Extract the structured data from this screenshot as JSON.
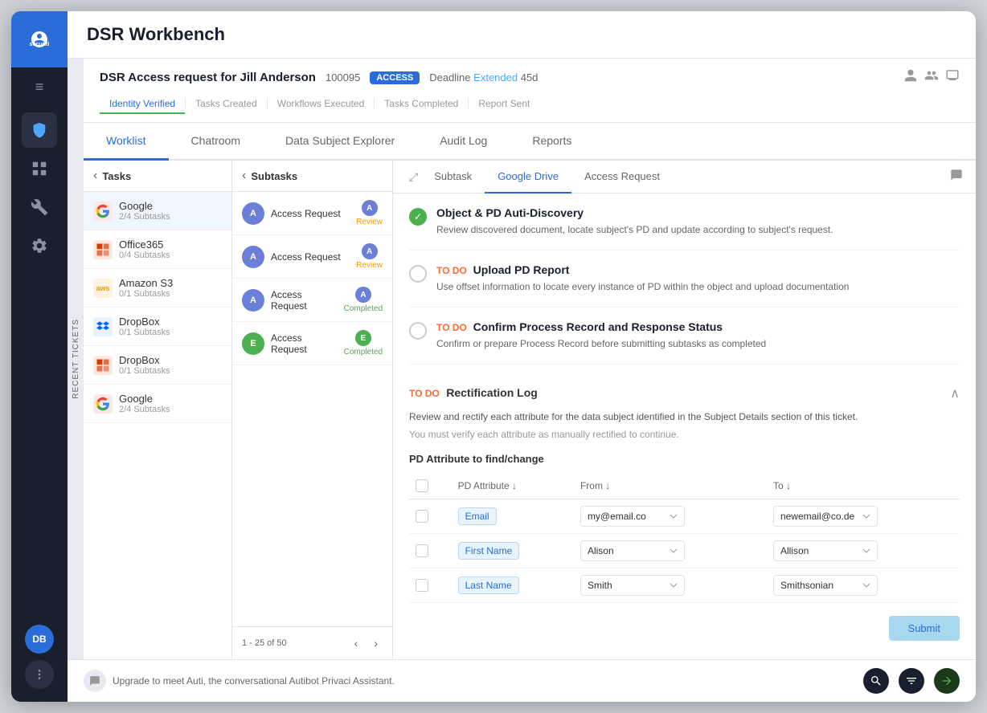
{
  "app": {
    "title": "DSR Workbench",
    "logo_text": "securiti"
  },
  "sidebar": {
    "nav_items": [
      {
        "id": "menu",
        "icon": "≡",
        "label": "menu-toggle"
      },
      {
        "id": "shield",
        "icon": "🛡",
        "label": "shield-icon",
        "active": true
      },
      {
        "id": "dashboard",
        "icon": "▦",
        "label": "dashboard-icon"
      },
      {
        "id": "wrench",
        "icon": "🔧",
        "label": "wrench-icon"
      },
      {
        "id": "gear",
        "icon": "⚙",
        "label": "gear-icon"
      }
    ],
    "user_initials": "DB"
  },
  "dsr_header": {
    "title": "DSR Access request for Jill Anderson",
    "id": "100095",
    "badge": "ACCESS",
    "deadline_label": "Deadline",
    "deadline_status": "Extended",
    "deadline_days": "45d",
    "tabs": [
      {
        "id": "identity",
        "label": "Identity Verified",
        "active": true
      },
      {
        "id": "tasks",
        "label": "Tasks Created"
      },
      {
        "id": "workflows",
        "label": "Workflows Executed"
      },
      {
        "id": "completed",
        "label": "Tasks Completed"
      },
      {
        "id": "report",
        "label": "Report Sent"
      }
    ]
  },
  "main_tabs": [
    {
      "id": "worklist",
      "label": "Worklist",
      "active": true
    },
    {
      "id": "chatroom",
      "label": "Chatroom"
    },
    {
      "id": "data_explorer",
      "label": "Data Subject Explorer"
    },
    {
      "id": "audit",
      "label": "Audit Log"
    },
    {
      "id": "reports",
      "label": "Reports"
    }
  ],
  "recent_tickets": {
    "label": "RECENT TICKETS"
  },
  "tasks": {
    "header": "Tasks",
    "items": [
      {
        "id": 1,
        "name": "Google",
        "subtasks": "2/4 Subtasks",
        "logo_color": "#ea4335",
        "logo_text": "G",
        "active": true
      },
      {
        "id": 2,
        "name": "Office365",
        "subtasks": "0/4 Subtasks",
        "logo_color": "#d83b01",
        "logo_text": "O"
      },
      {
        "id": 3,
        "name": "Amazon S3",
        "subtasks": "0/1 Subtasks",
        "logo_color": "#ff9900",
        "logo_text": "aws"
      },
      {
        "id": 4,
        "name": "DropBox",
        "subtasks": "0/1 Subtasks",
        "logo_color": "#0061ff",
        "logo_text": "D"
      },
      {
        "id": 5,
        "name": "DropBox",
        "subtasks": "0/1 Subtasks",
        "logo_color": "#d83b01",
        "logo_text": "O"
      },
      {
        "id": 6,
        "name": "Google",
        "subtasks": "2/4 Subtasks",
        "logo_color": "#ea4335",
        "logo_text": "G"
      }
    ]
  },
  "subtasks": {
    "header": "Subtasks",
    "items": [
      {
        "id": 1,
        "name": "Access Request",
        "avatar_letter": "A",
        "avatar_color": "#6c7fd8",
        "badge": "A",
        "badge_type": "a",
        "status": "Review"
      },
      {
        "id": 2,
        "name": "Access Request",
        "avatar_letter": "A",
        "avatar_color": "#6c7fd8",
        "badge": "A",
        "badge_type": "a",
        "status": "Review"
      },
      {
        "id": 3,
        "name": "Access Request",
        "avatar_letter": "A",
        "avatar_color": "#6c7fd8",
        "badge": "A",
        "badge_type": "a",
        "status": "Completed"
      },
      {
        "id": 4,
        "name": "Access Request",
        "avatar_letter": "E",
        "avatar_color": "#4caf50",
        "badge": "E",
        "badge_type": "e",
        "status": "Completed"
      }
    ],
    "pagination": "1 - 25 of 50"
  },
  "detail_tabs": [
    {
      "id": "subtask",
      "label": "Subtask"
    },
    {
      "id": "google_drive",
      "label": "Google Drive",
      "active": true
    },
    {
      "id": "access_request",
      "label": "Access Request"
    }
  ],
  "task_details": {
    "items": [
      {
        "id": 1,
        "status": "completed",
        "title": "Object & PD Auti-Discovery",
        "desc": "Review discovered document, locate subject's PD and update according to subject's request."
      },
      {
        "id": 2,
        "status": "todo",
        "todo_label": "TO DO",
        "action": "Upload PD Report",
        "desc": "Use offset information to locate every instance of PD within the object and upload documentation"
      },
      {
        "id": 3,
        "status": "todo",
        "todo_label": "TO DO",
        "action": "Confirm Process Record and Response Status",
        "desc": "Confirm or prepare Process Record before submitting subtasks as completed"
      }
    ],
    "rectification": {
      "todo_label": "TO DO",
      "title": "Rectification Log",
      "desc": "Review and rectify each attribute for the data subject identified in the Subject Details section of this ticket.",
      "note": "You must verify each attribute as manually rectified to continue.",
      "pd_title": "PD Attribute to find/change",
      "columns": [
        "",
        "PD Attribute ↓",
        "From ↓",
        "To ↓"
      ],
      "rows": [
        {
          "id": 1,
          "attribute": "Email",
          "from": "my@email.co",
          "to": "newemail@co.de"
        },
        {
          "id": 2,
          "attribute": "First Name",
          "from": "Alison",
          "to": "Allison"
        },
        {
          "id": 3,
          "attribute": "Last Name",
          "from": "Smith",
          "to": "Smithsonian"
        }
      ],
      "submit_label": "Submit"
    }
  },
  "bottom_bar": {
    "prompt": "Upgrade to meet Auti, the conversational Autibot Privaci Assistant."
  }
}
